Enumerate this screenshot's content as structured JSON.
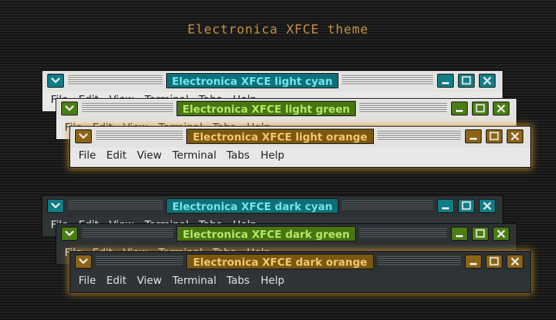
{
  "page": {
    "title": "Electronica XFCE theme"
  },
  "menu_labels": [
    "File",
    "Edit",
    "View",
    "Terminal",
    "Tabs",
    "Help"
  ],
  "windows": [
    {
      "variant": "light-cyan",
      "title": "Electronica XFCE light cyan",
      "accent": "#0f7d86",
      "title_color": "#6fe6ee"
    },
    {
      "variant": "light-green",
      "title": "Electronica XFCE light green",
      "accent": "#4b7d12",
      "title_color": "#b2e866"
    },
    {
      "variant": "light-orange",
      "title": "Electronica XFCE light orange",
      "accent": "#8c6414",
      "title_color": "#f1c76a"
    },
    {
      "variant": "dark-cyan",
      "title": "Electronica XFCE dark cyan",
      "accent": "#0f7d86",
      "title_color": "#6fe6ee"
    },
    {
      "variant": "dark-green",
      "title": "Electronica XFCE dark green",
      "accent": "#4b7d12",
      "title_color": "#b2e866"
    },
    {
      "variant": "dark-orange",
      "title": "Electronica XFCE dark orange",
      "accent": "#8c6414",
      "title_color": "#f1c76a"
    }
  ],
  "colors": {
    "page_title": "#c7903c",
    "focus_glow": "#d69628",
    "light_window_bg": "#e8e8e6",
    "dark_window_bg": "#2f3436"
  },
  "icons": [
    "chevron-down-icon",
    "minimize-icon",
    "maximize-icon",
    "close-icon"
  ]
}
